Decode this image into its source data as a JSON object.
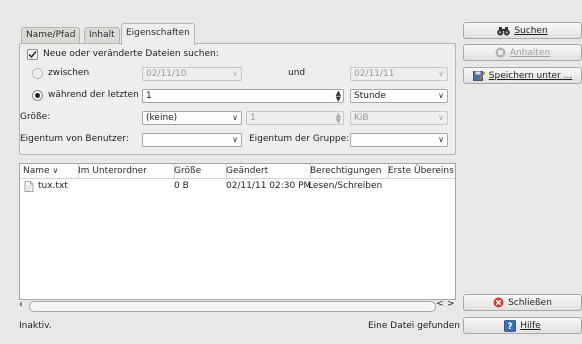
{
  "tabs": [
    {
      "label": "Name/Pfad",
      "active": false
    },
    {
      "label": "Inhalt",
      "active": false
    },
    {
      "label": "Eigenschaften",
      "active": true
    }
  ],
  "properties": {
    "new_or_changed_label": "Neue oder veränderte Dateien suchen:",
    "between_label": "zwischen",
    "between_from": "02/11/10",
    "and_label": "und",
    "between_to": "02/11/11",
    "during_last_label": "während der letzten",
    "during_last_value": "1",
    "during_last_unit": "Stunde",
    "size_label": "Größe:",
    "size_mode": "(keine)",
    "size_value": "1",
    "size_unit": "KiB",
    "owner_user_label": "Eigentum von Benutzer:",
    "owner_user_value": "",
    "owner_group_label": "Eigentum der Gruppe:",
    "owner_group_value": ""
  },
  "results": {
    "columns": [
      "Name",
      "Im Unterordner",
      "Größe",
      "Geändert",
      "Berechtigungen",
      "Erste Übereins"
    ],
    "rows": [
      {
        "name": "tux.txt",
        "subfolder": "",
        "size": "0 B",
        "modified": "02/11/11 02:30 PM",
        "permissions": "Lesen/Schreiben",
        "first_match": ""
      }
    ]
  },
  "buttons": {
    "search": "Suchen",
    "stop": "Anhalten",
    "save_as": "Speichern unter ...",
    "close": "Schließen",
    "help": "Hilfe"
  },
  "status": {
    "left": "Inaktiv.",
    "right": "Eine Datei gefunden"
  }
}
